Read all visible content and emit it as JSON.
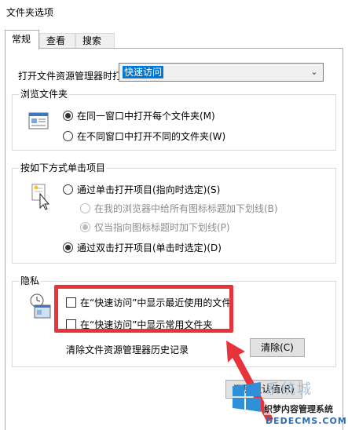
{
  "window": {
    "title": "文件夹选项"
  },
  "tabs": [
    {
      "label": "常规",
      "active": true
    },
    {
      "label": "查看",
      "active": false
    },
    {
      "label": "搜索",
      "active": false
    }
  ],
  "open_in": {
    "label": "打开文件资源管理器时打",
    "selected": "快速访问"
  },
  "browse": {
    "title": "浏览文件夹",
    "options": [
      {
        "label": "在同一窗口中打开每个文件夹(M)",
        "checked": true
      },
      {
        "label": "在不同窗口中打开不同的文件夹(W)",
        "checked": false
      }
    ]
  },
  "click": {
    "title": "按如下方式单击项目",
    "single": "通过单击打开项目(指向时选定)(S)",
    "sub1": "在我的浏览器中给所有图标标题加下划线(B)",
    "sub2": "仅当指向图标标题时加下划线(P)",
    "double": "通过双击打开项目(单击时选定)(D)"
  },
  "privacy": {
    "title": "隐私",
    "recent": "在“快速访问”中显示最近使用的文件",
    "frequent": "在“快速访问”中显示常用文件夹",
    "clear_label": "清除文件资源管理器历史记录",
    "clear_button": "清除(C)"
  },
  "restore_button": "还原默认值(R)",
  "watermark": {
    "cn1": "系统城",
    "cn2": "织梦内容管理系统",
    "en": "DEDECMS.COM"
  },
  "colors": {
    "highlight": "#e8323c",
    "selection": "#0078d7"
  }
}
